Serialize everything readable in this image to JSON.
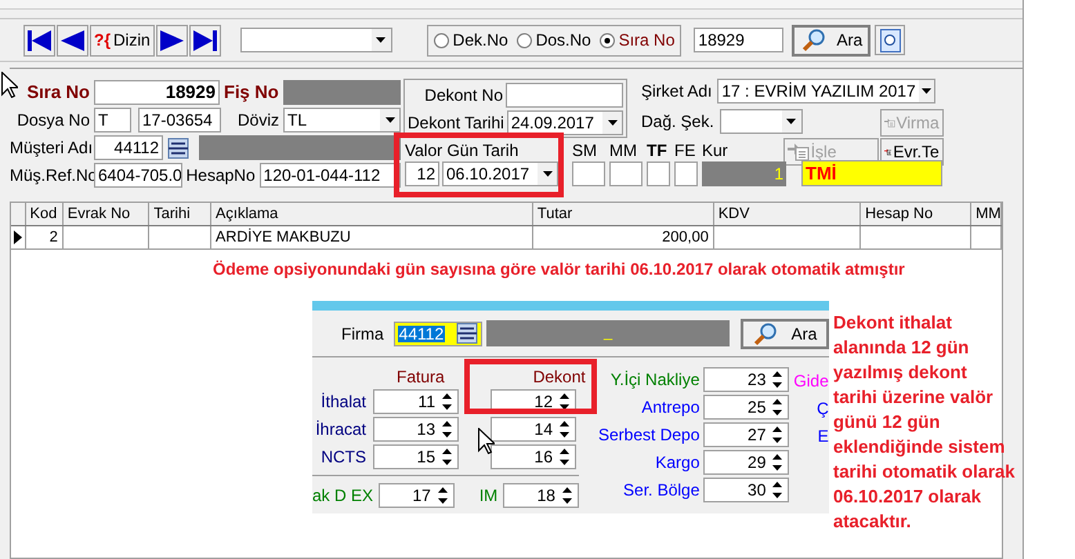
{
  "toolbar": {
    "index_icon": "?{",
    "index_button": "Dizin",
    "search_modes": [
      {
        "label": "Dek.No",
        "selected": false
      },
      {
        "label": "Dos.No",
        "selected": false
      },
      {
        "label": "Sıra No",
        "selected": true
      }
    ],
    "search_value": "18929",
    "search_button": "Ara"
  },
  "form": {
    "sira_no_label": "Sıra No",
    "sira_no": "18929",
    "fis_no_label": "Fiş No",
    "dosya_no_label": "Dosya No",
    "dosya_type": "T",
    "dosya_no": "17-03654",
    "doviz_label": "Döviz",
    "doviz": "TL",
    "musteri_label": "Müşteri Adı",
    "musteri_code": "44112",
    "ref_label": "Müş.Ref.No",
    "ref": "6404-705.0",
    "hesap_label": "HesapNo",
    "hesap": "120-01-044-112",
    "dekont_no_label": "Dekont No",
    "dekont_tarihi_label": "Dekont Tarihi",
    "dekont_tarihi": "24.09.2017",
    "valor_label": "Valor Gün Tarih",
    "valor_gun": "12",
    "valor_tarih": "06.10.2017",
    "small_labels": [
      "SM",
      "MM",
      "TF",
      "FE",
      "Kur"
    ],
    "kur": "1",
    "tmi": "TMİ",
    "sirket_label": "Şirket Adı",
    "sirket": "17 : EVRİM YAZILIM 2017",
    "dag_sek_label": "Dağ. Şek.",
    "buttons": [
      {
        "label": "Virma",
        "disabled": true
      },
      {
        "label": "İşle",
        "disabled": true
      },
      {
        "label": "Evr.Te",
        "disabled": false
      }
    ]
  },
  "table": {
    "columns": [
      "Kod",
      "Evrak No",
      "Tarihi",
      "Açıklama",
      "Tutar",
      "KDV",
      "Hesap No",
      "MM"
    ],
    "rows": [
      {
        "kod": "2",
        "aciklama": "ARDİYE MAKBUZU",
        "tutar": "200,00",
        "selected": true
      }
    ]
  },
  "note_top": "Ödeme opsiyonundaki gün sayısına göre valör tarihi 06.10.2017 olarak otomatik atmıştır",
  "inset": {
    "firma_label": "Firma",
    "firma_code": "44112",
    "firma_name": "_",
    "search_button": "Ara",
    "fatura_header": "Fatura",
    "dekont_header": "Dekont",
    "rows": [
      {
        "label": "İthalat",
        "fatura": "11",
        "dekont": "12"
      },
      {
        "label": "İhracat",
        "fatura": "13",
        "dekont": "14"
      },
      {
        "label": "NCTS",
        "fatura": "15",
        "dekont": "16"
      }
    ],
    "bottom": [
      {
        "label": "ak D EX",
        "value": "17"
      },
      {
        "label": "IM",
        "value": "18"
      }
    ],
    "right": [
      {
        "label": "Y.İçi Nakliye",
        "value": "23",
        "color": "#008000"
      },
      {
        "label": "Antrepo",
        "value": "25",
        "color": "#0000ff"
      },
      {
        "label": "Serbest Depo",
        "value": "27",
        "color": "#0000ff"
      },
      {
        "label": "Kargo",
        "value": "29",
        "color": "#0000ff"
      },
      {
        "label": "Ser. Bölge",
        "value": "30",
        "color": "#0000ff"
      }
    ],
    "cut_labels": [
      {
        "label": "Gide",
        "color": "#ff00ff"
      },
      {
        "label": "Ç",
        "color": "#0000ff"
      },
      {
        "label": "E",
        "color": "#0000ff"
      }
    ]
  },
  "note_side": "Dekont ithalat alanında 12 gün yazılmış dekont tarihi üzerine valör günü 12 gün eklendiğinde sistem tarihi otomatik olarak 06.10.2017 olarak atacaktır."
}
